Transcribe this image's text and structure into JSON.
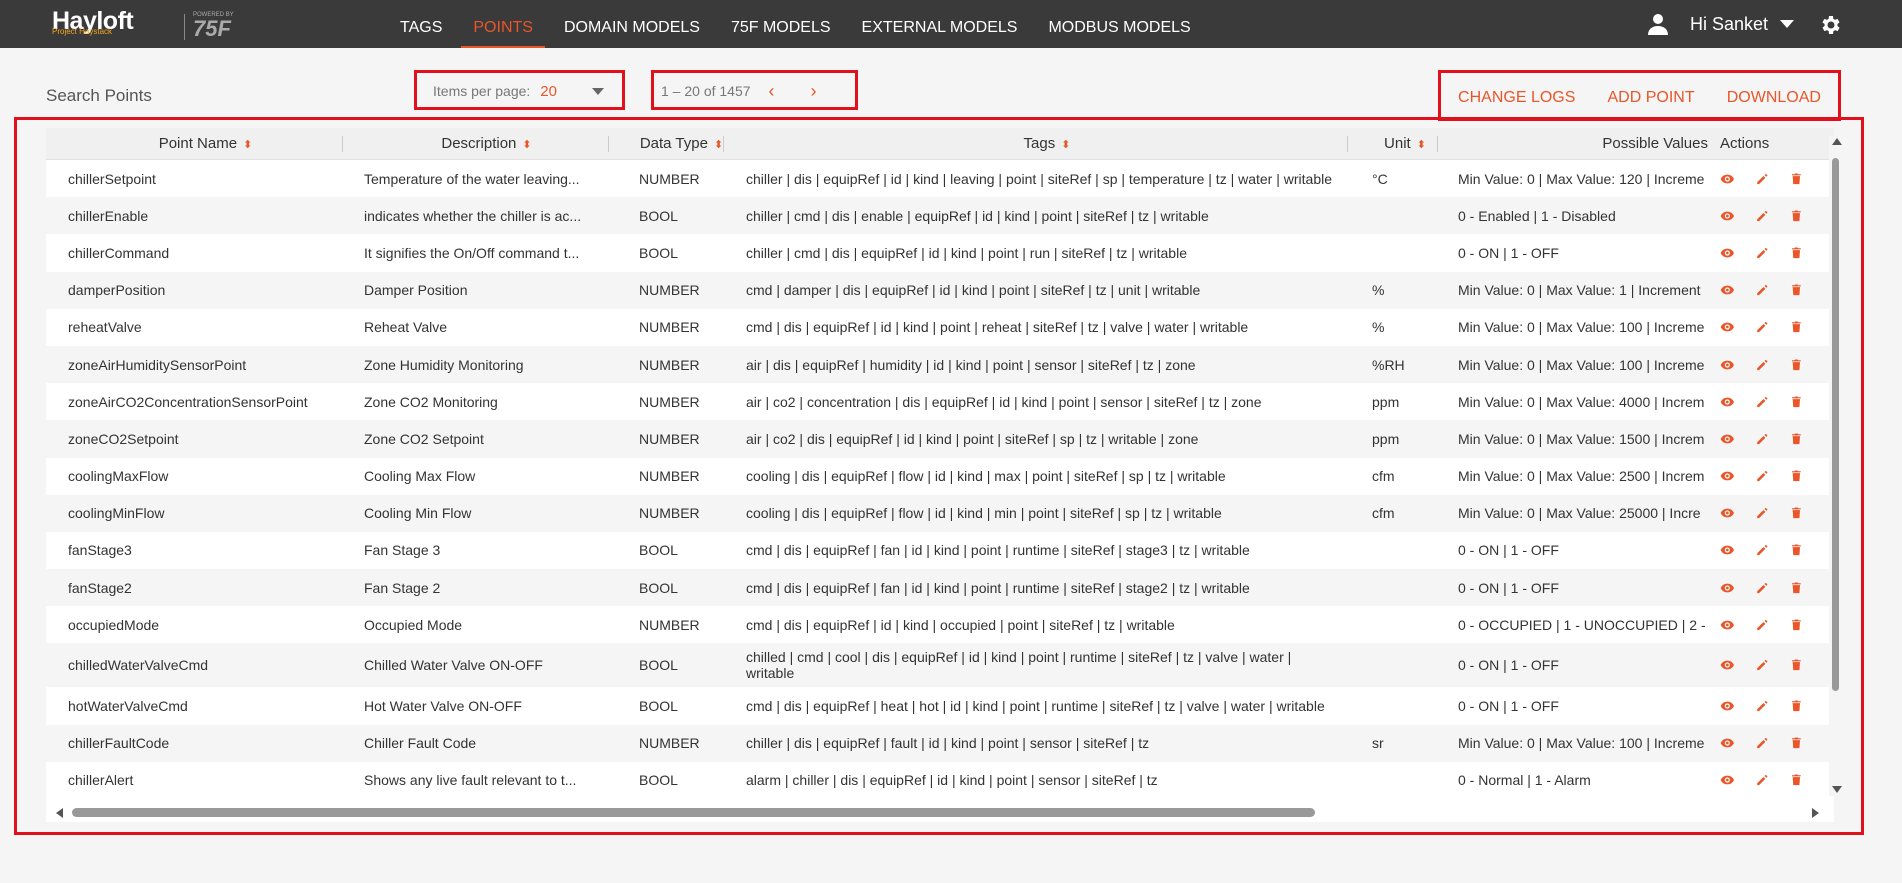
{
  "brand": {
    "name": "Hayloft",
    "sub": "Project Haystack",
    "powered": "POWERED BY",
    "partner": "75F"
  },
  "nav": [
    "TAGS",
    "POINTS",
    "DOMAIN MODELS",
    "75F MODELS",
    "EXTERNAL MODELS",
    "MODBUS MODELS"
  ],
  "nav_active": "POINTS",
  "user": {
    "greeting": "Hi Sanket"
  },
  "toolbar": {
    "search_label": "Search Points",
    "items_per_page_label": "Items per page:",
    "items_per_page_value": "20",
    "range": "1 – 20 of 1457",
    "prev": "‹",
    "next": "›",
    "change_logs": "CHANGE LOGS",
    "add_point": "ADD POINT",
    "download": "DOWNLOAD"
  },
  "colors": {
    "accent": "#e8562a",
    "topbar": "#3a3a3a",
    "highlight": "#e0101c"
  },
  "table": {
    "headers": [
      "Point Name",
      "Description",
      "Data Type",
      "Tags",
      "Unit",
      "Possible Values",
      "Actions"
    ],
    "rows": [
      [
        "chillerSetpoint",
        "Temperature of the water leaving...",
        "NUMBER",
        "chiller | dis | equipRef | id | kind | leaving | point | siteRef | sp | temperature | tz | water | writable",
        "°C",
        "Min Value: 0 | Max Value: 120 | Increme"
      ],
      [
        "chillerEnable",
        "indicates whether the chiller is ac...",
        "BOOL",
        "chiller | cmd | dis | enable | equipRef | id | kind | point | siteRef | tz | writable",
        "",
        "0 - Enabled | 1 - Disabled"
      ],
      [
        "chillerCommand",
        "It signifies the On/Off command t...",
        "BOOL",
        "chiller | cmd | dis | equipRef | id | kind | point | run | siteRef | tz | writable",
        "",
        "0 - ON | 1 - OFF"
      ],
      [
        "damperPosition",
        "Damper Position",
        "NUMBER",
        "cmd | damper | dis | equipRef | id | kind | point | siteRef | tz | unit | writable",
        "%",
        "Min Value: 0 | Max Value: 1 | Increment"
      ],
      [
        "reheatValve",
        "Reheat Valve",
        "NUMBER",
        "cmd | dis | equipRef | id | kind | point | reheat | siteRef | tz | valve | water | writable",
        "%",
        "Min Value: 0 | Max Value: 100 | Increme"
      ],
      [
        "zoneAirHumiditySensorPoint",
        "Zone Humidity Monitoring",
        "NUMBER",
        "air | dis | equipRef | humidity | id | kind | point | sensor | siteRef | tz | zone",
        "%RH",
        "Min Value: 0 | Max Value: 100 | Increme"
      ],
      [
        "zoneAirCO2ConcentrationSensorPoint",
        "Zone CO2 Monitoring",
        "NUMBER",
        "air | co2 | concentration | dis | equipRef | id | kind | point | sensor | siteRef | tz | zone",
        "ppm",
        "Min Value: 0 | Max Value: 4000 | Increm"
      ],
      [
        "zoneCO2Setpoint",
        "Zone CO2 Setpoint",
        "NUMBER",
        "air | co2 | dis | equipRef | id | kind | point | siteRef | sp | tz | writable | zone",
        "ppm",
        "Min Value: 0 | Max Value: 1500 | Increm"
      ],
      [
        "coolingMaxFlow",
        "Cooling Max Flow",
        "NUMBER",
        "cooling | dis | equipRef | flow | id | kind | max | point | siteRef | sp | tz | writable",
        "cfm",
        "Min Value: 0 | Max Value: 2500 | Increm"
      ],
      [
        "coolingMinFlow",
        "Cooling Min Flow",
        "NUMBER",
        "cooling | dis | equipRef | flow | id | kind | min | point | siteRef | sp | tz | writable",
        "cfm",
        "Min Value: 0 | Max Value: 25000 | Incre"
      ],
      [
        "fanStage3",
        "Fan Stage 3",
        "BOOL",
        "cmd | dis | equipRef | fan | id | kind | point | runtime | siteRef | stage3 | tz | writable",
        "",
        "0 - ON | 1 - OFF"
      ],
      [
        "fanStage2",
        "Fan Stage 2",
        "BOOL",
        "cmd | dis | equipRef | fan | id | kind | point | runtime | siteRef | stage2 | tz | writable",
        "",
        "0 - ON | 1 - OFF"
      ],
      [
        "occupiedMode",
        "Occupied Mode",
        "NUMBER",
        "cmd | dis | equipRef | id | kind | occupied | point | siteRef | tz | writable",
        "",
        "0 - OCCUPIED | 1 - UNOCCUPIED | 2 -"
      ],
      [
        "chilledWaterValveCmd",
        "Chilled Water Valve ON-OFF",
        "BOOL",
        "chilled | cmd | cool | dis | equipRef | id | kind | point | runtime | siteRef | tz | valve | water | writable",
        "",
        "0 - ON | 1 - OFF"
      ],
      [
        "hotWaterValveCmd",
        "Hot Water Valve ON-OFF",
        "BOOL",
        "cmd | dis | equipRef | heat | hot | id | kind | point | runtime | siteRef | tz | valve | water | writable",
        "",
        "0 - ON | 1 - OFF"
      ],
      [
        "chillerFaultCode",
        "Chiller Fault Code",
        "NUMBER",
        "chiller | dis | equipRef | fault | id | kind | point | sensor | siteRef | tz",
        "sr",
        "Min Value: 0 | Max Value: 100 | Increme"
      ],
      [
        "chillerAlert",
        "Shows any live fault relevant to t...",
        "BOOL",
        "alarm | chiller | dis | equipRef | id | kind | point | sensor | siteRef | tz",
        "",
        "0 - Normal | 1 - Alarm"
      ]
    ],
    "row_action_icons": [
      "eye-icon",
      "pencil-icon",
      "trash-icon"
    ]
  }
}
